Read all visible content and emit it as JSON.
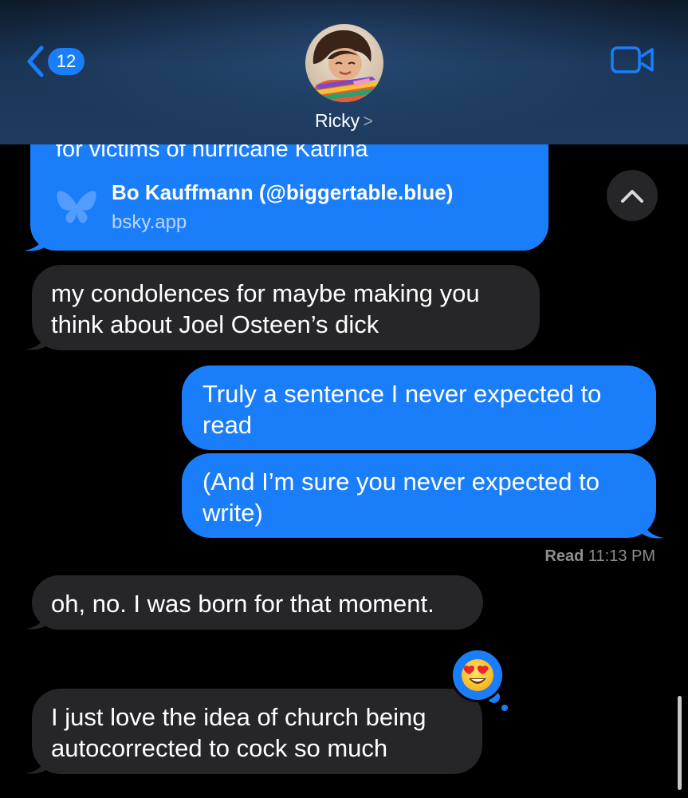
{
  "header": {
    "back_count": "12",
    "contact_name": "Ricky",
    "contact_chevron": ">"
  },
  "link_preview": {
    "cut_text": "for victims of hurricane Katrina",
    "title": "Bo Kauffmann (@biggertable.blue)",
    "domain": "bsky.app"
  },
  "messages": [
    {
      "from": "them",
      "text": "my condolences for maybe making you think about Joel Osteen’s dick"
    },
    {
      "from": "me",
      "text": "Truly a sentence I never expected to read"
    },
    {
      "from": "me",
      "text": "(And I’m sure you never expected to write)"
    },
    {
      "from": "them",
      "text": "oh, no. I was born for that moment."
    },
    {
      "from": "them",
      "text": "I just love the idea of church being autocorrected to cock so much",
      "reaction": "heart-eyes-emoji"
    }
  ],
  "read_receipt": {
    "label": "Read",
    "time": "11:13 PM"
  },
  "colors": {
    "accent_blue": "#1a7efb",
    "incoming_bubble": "#262629",
    "background": "#000000"
  },
  "icons": [
    "back-chevron-icon",
    "video-camera-icon",
    "butterfly-icon",
    "chevron-up-icon",
    "heart-eyes-emoji"
  ]
}
